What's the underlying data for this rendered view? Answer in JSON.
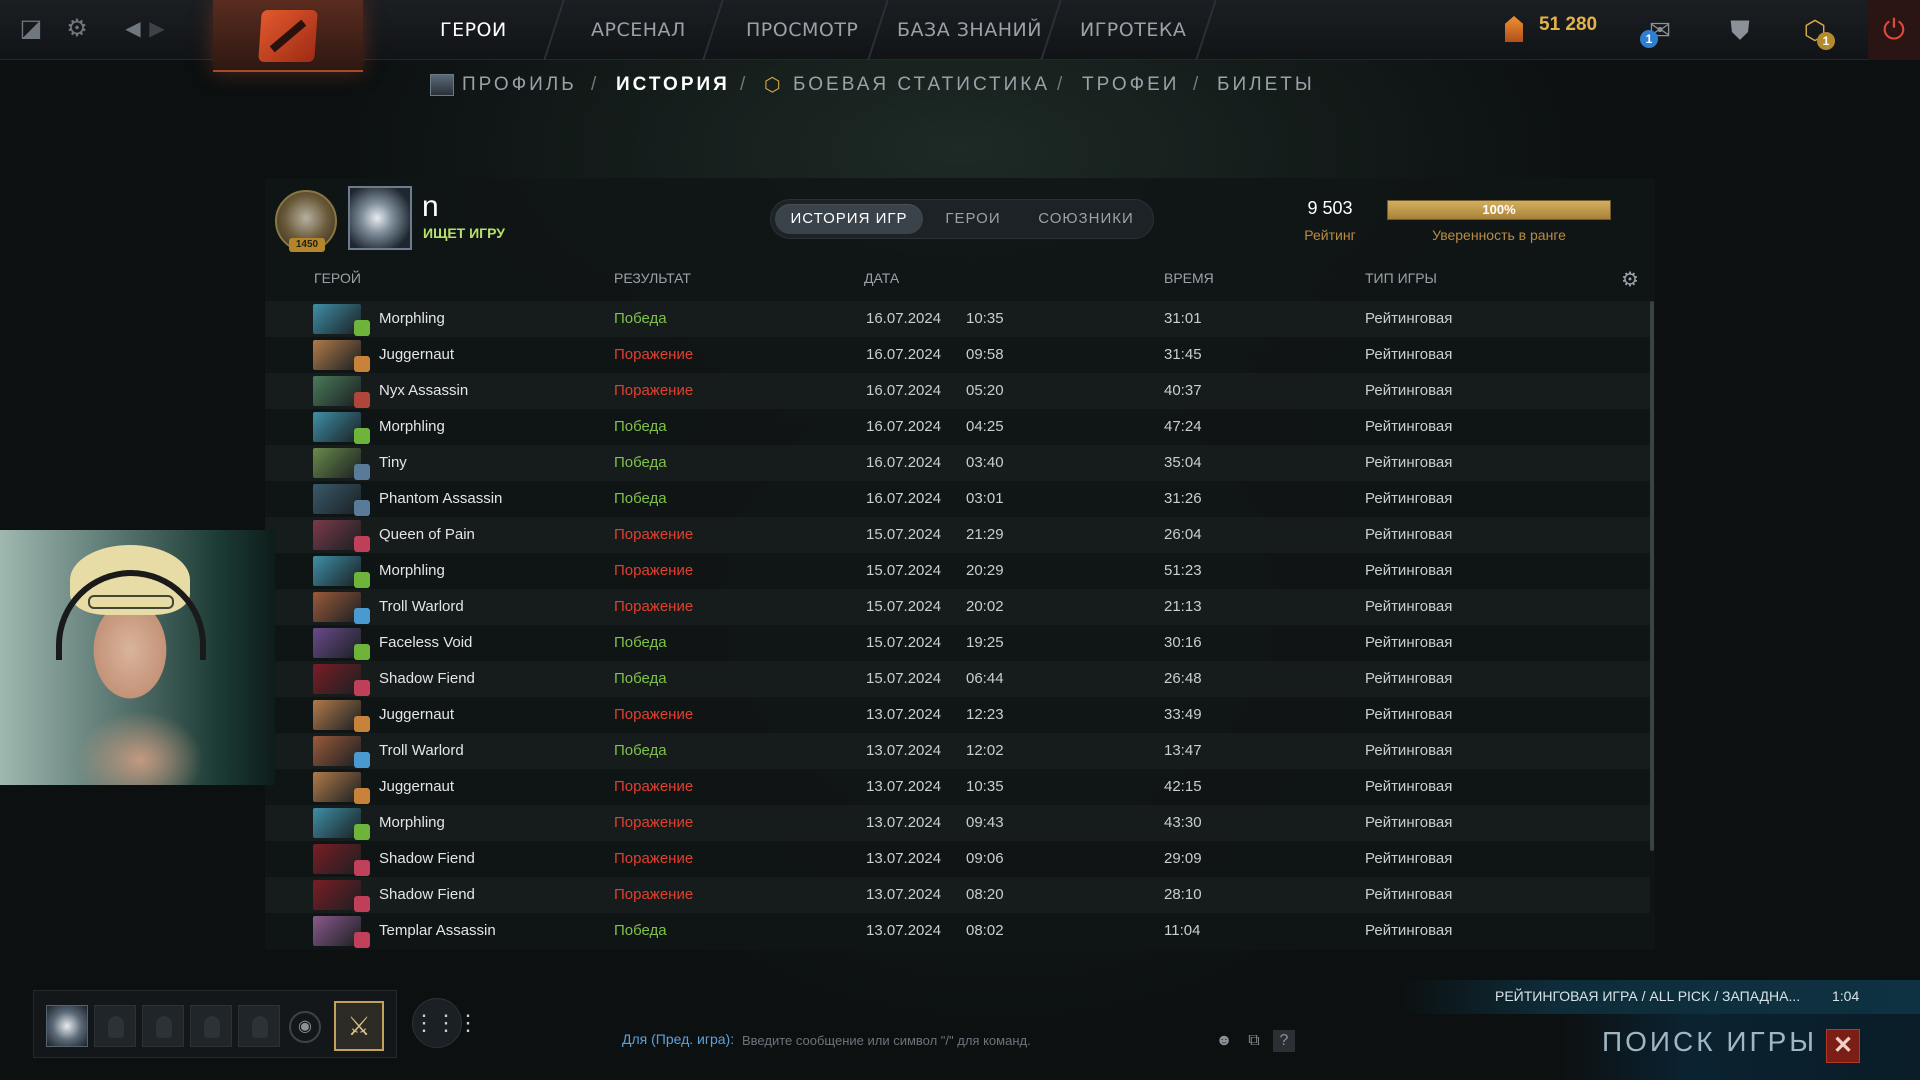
{
  "topbar": {
    "tabs": [
      {
        "label": "ГЕРОИ",
        "active": true
      },
      {
        "label": "АРСЕНАЛ",
        "active": false
      },
      {
        "label": "ПРОСМОТР",
        "active": false
      },
      {
        "label": "БАЗА ЗНАНИЙ",
        "active": false
      },
      {
        "label": "ИГРОТЕКА",
        "active": false
      }
    ],
    "currency": "51 280",
    "notification_count": "1",
    "plus_count": "1",
    "icons": [
      "dota-icon",
      "gear-icon",
      "back-icon",
      "forward-icon",
      "shards-icon",
      "chat-icon",
      "armory-icon",
      "plus-icon",
      "power-icon"
    ]
  },
  "subnav": [
    {
      "label": "ПРОФИЛЬ",
      "active": false
    },
    {
      "label": "ИСТОРИЯ",
      "active": true
    },
    {
      "label": "БОЕВАЯ СТАТИСТИКА",
      "active": false
    },
    {
      "label": "ТРОФЕИ",
      "active": false
    },
    {
      "label": "БИЛЕТЫ",
      "active": false
    }
  ],
  "profile": {
    "rank_badge": "1450",
    "name": "n",
    "status": "ИЩЕТ ИГРУ",
    "rating_value": "9 503",
    "rating_label": "Рейтинг",
    "confidence_value": "100%",
    "confidence_label": "Уверенность в ранге"
  },
  "history_tabs": [
    {
      "label": "ИСТОРИЯ ИГР",
      "active": true
    },
    {
      "label": "ГЕРОИ",
      "active": false
    },
    {
      "label": "СОЮЗНИКИ",
      "active": false
    }
  ],
  "table": {
    "headers": {
      "hero": "ГЕРОЙ",
      "result": "РЕЗУЛЬТАТ",
      "date": "ДАТА",
      "time": "ВРЕМЯ",
      "type": "ТИП ИГРЫ"
    },
    "rows": [
      {
        "hero": "Morphling",
        "result": "Победа",
        "win": true,
        "date": "16.07.2024",
        "clock": "10:35",
        "duration": "31:01",
        "type": "Рейтинговая",
        "color": "#3f8fa6",
        "attr": "#6fb43a"
      },
      {
        "hero": "Juggernaut",
        "result": "Поражение",
        "win": false,
        "date": "16.07.2024",
        "clock": "09:58",
        "duration": "31:45",
        "type": "Рейтинговая",
        "color": "#b07a4a",
        "attr": "#c9823a"
      },
      {
        "hero": "Nyx Assassin",
        "result": "Поражение",
        "win": false,
        "date": "16.07.2024",
        "clock": "05:20",
        "duration": "40:37",
        "type": "Рейтинговая",
        "color": "#4a7a5a",
        "attr": "#b0453a"
      },
      {
        "hero": "Morphling",
        "result": "Победа",
        "win": true,
        "date": "16.07.2024",
        "clock": "04:25",
        "duration": "47:24",
        "type": "Рейтинговая",
        "color": "#3f8fa6",
        "attr": "#6fb43a"
      },
      {
        "hero": "Tiny",
        "result": "Победа",
        "win": true,
        "date": "16.07.2024",
        "clock": "03:40",
        "duration": "35:04",
        "type": "Рейтинговая",
        "color": "#6a8a4a",
        "attr": "#5a7a9a"
      },
      {
        "hero": "Phantom Assassin",
        "result": "Победа",
        "win": true,
        "date": "16.07.2024",
        "clock": "03:01",
        "duration": "31:26",
        "type": "Рейтинговая",
        "color": "#3a5a6a",
        "attr": "#5a7a9a"
      },
      {
        "hero": "Queen of Pain",
        "result": "Поражение",
        "win": false,
        "date": "15.07.2024",
        "clock": "21:29",
        "duration": "26:04",
        "type": "Рейтинговая",
        "color": "#7a3a4a",
        "attr": "#c0405a"
      },
      {
        "hero": "Morphling",
        "result": "Поражение",
        "win": false,
        "date": "15.07.2024",
        "clock": "20:29",
        "duration": "51:23",
        "type": "Рейтинговая",
        "color": "#3f8fa6",
        "attr": "#6fb43a"
      },
      {
        "hero": "Troll Warlord",
        "result": "Поражение",
        "win": false,
        "date": "15.07.2024",
        "clock": "20:02",
        "duration": "21:13",
        "type": "Рейтинговая",
        "color": "#9a5a3a",
        "attr": "#4a9ad0"
      },
      {
        "hero": "Faceless Void",
        "result": "Победа",
        "win": true,
        "date": "15.07.2024",
        "clock": "19:25",
        "duration": "30:16",
        "type": "Рейтинговая",
        "color": "#6a4a8a",
        "attr": "#6fb43a"
      },
      {
        "hero": "Shadow Fiend",
        "result": "Победа",
        "win": true,
        "date": "15.07.2024",
        "clock": "06:44",
        "duration": "26:48",
        "type": "Рейтинговая",
        "color": "#7a1e24",
        "attr": "#c0405a"
      },
      {
        "hero": "Juggernaut",
        "result": "Поражение",
        "win": false,
        "date": "13.07.2024",
        "clock": "12:23",
        "duration": "33:49",
        "type": "Рейтинговая",
        "color": "#b07a4a",
        "attr": "#c9823a"
      },
      {
        "hero": "Troll Warlord",
        "result": "Победа",
        "win": true,
        "date": "13.07.2024",
        "clock": "12:02",
        "duration": "13:47",
        "type": "Рейтинговая",
        "color": "#9a5a3a",
        "attr": "#4a9ad0"
      },
      {
        "hero": "Juggernaut",
        "result": "Поражение",
        "win": false,
        "date": "13.07.2024",
        "clock": "10:35",
        "duration": "42:15",
        "type": "Рейтинговая",
        "color": "#b07a4a",
        "attr": "#c9823a"
      },
      {
        "hero": "Morphling",
        "result": "Поражение",
        "win": false,
        "date": "13.07.2024",
        "clock": "09:43",
        "duration": "43:30",
        "type": "Рейтинговая",
        "color": "#3f8fa6",
        "attr": "#6fb43a"
      },
      {
        "hero": "Shadow Fiend",
        "result": "Поражение",
        "win": false,
        "date": "13.07.2024",
        "clock": "09:06",
        "duration": "29:09",
        "type": "Рейтинговая",
        "color": "#7a1e24",
        "attr": "#c0405a"
      },
      {
        "hero": "Shadow Fiend",
        "result": "Поражение",
        "win": false,
        "date": "13.07.2024",
        "clock": "08:20",
        "duration": "28:10",
        "type": "Рейтинговая",
        "color": "#7a1e24",
        "attr": "#c0405a"
      },
      {
        "hero": "Templar Assassin",
        "result": "Победа",
        "win": true,
        "date": "13.07.2024",
        "clock": "08:02",
        "duration": "11:04",
        "type": "Рейтинговая",
        "color": "#8a5a8a",
        "attr": "#c0405a"
      }
    ]
  },
  "chat": {
    "channel": "Для (Пред. игра):",
    "placeholder": "Введите сообщение или символ \"/\" для команд."
  },
  "queue": {
    "mode": "РЕЙТИНГОВАЯ ИГРА / ALL PICK / ЗАПАДНА...",
    "elapsed": "1:04",
    "search_label": "ПОИСК ИГРЫ"
  },
  "colors": {
    "win": "#7fc24a",
    "loss": "#e0402f",
    "accent": "#b98c43"
  }
}
